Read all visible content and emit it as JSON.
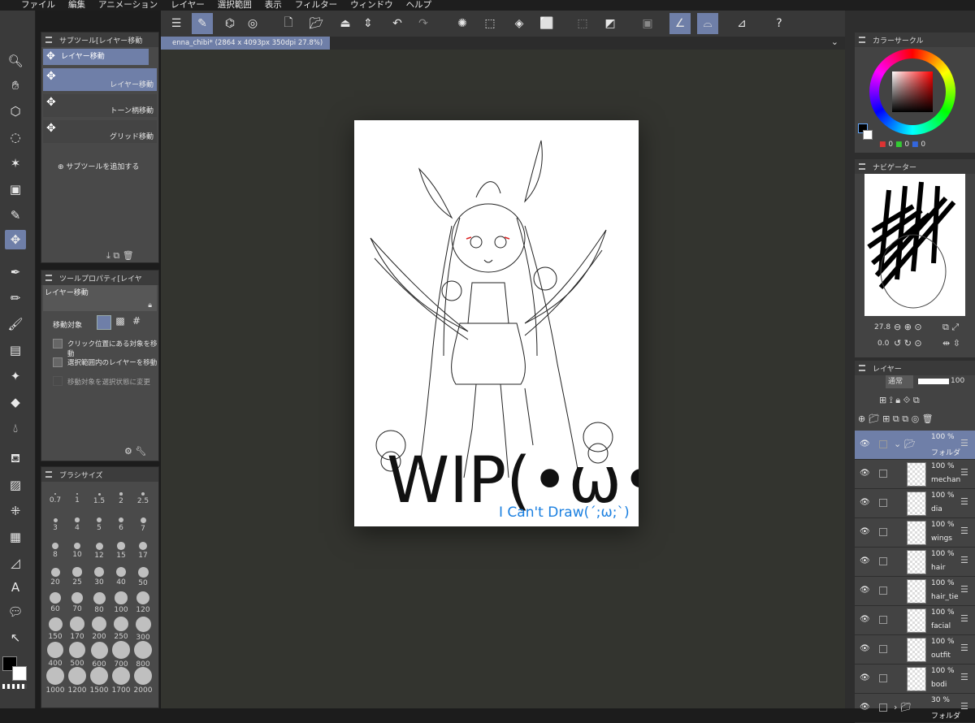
{
  "menu": {
    "items": [
      "ファイル",
      "編集",
      "アニメーション",
      "レイヤー",
      "選択範囲",
      "表示",
      "フィルター",
      "ウィンドウ",
      "ヘルプ"
    ]
  },
  "document": {
    "tab_label": "enna_chibi* (2864 x 4093px 350dpi 27.8%)"
  },
  "subtool": {
    "header": "サブツール[レイヤー移動",
    "active_group": "レイヤー移動",
    "items": [
      "レイヤー移動",
      "トーン柄移動",
      "グリッド移動"
    ],
    "add_label": "サブツールを追加する"
  },
  "tool_property": {
    "header": "ツールプロパティ[レイヤ",
    "tool_name": "レイヤー移動",
    "move_target_label": "移動対象",
    "options": [
      "クリック位置にある対象を移動",
      "選択範囲内のレイヤーを移動",
      "移動対象を選択状態に変更"
    ]
  },
  "brush_size": {
    "header": "ブラシサイズ",
    "sizes": [
      "0.7",
      "1",
      "1.5",
      "2",
      "2.5",
      "3",
      "4",
      "5",
      "6",
      "7",
      "8",
      "10",
      "12",
      "15",
      "17",
      "20",
      "25",
      "30",
      "40",
      "50",
      "60",
      "70",
      "80",
      "100",
      "120",
      "150",
      "170",
      "200",
      "250",
      "300",
      "400",
      "500",
      "600",
      "700",
      "800",
      "1000",
      "1200",
      "1500",
      "1700",
      "2000"
    ]
  },
  "color_circle": {
    "header": "カラーサークル",
    "rgb": [
      "0",
      "0",
      "0"
    ]
  },
  "navigator": {
    "header": "ナビゲーター",
    "zoom": "27.8",
    "rotation": "0.0"
  },
  "layers_panel": {
    "header": "レイヤー",
    "blend_mode": "通常",
    "opacity": "100",
    "layers": [
      {
        "pct": "100 %",
        "name": "フォルダ"
      },
      {
        "pct": "100 %",
        "name": "mechani"
      },
      {
        "pct": "100 %",
        "name": "dia"
      },
      {
        "pct": "100 %",
        "name": "wings"
      },
      {
        "pct": "100 %",
        "name": "hair"
      },
      {
        "pct": "100 %",
        "name": "hair_tie"
      },
      {
        "pct": "100 %",
        "name": "facial"
      },
      {
        "pct": "100 %",
        "name": "outfit"
      },
      {
        "pct": "100 %",
        "name": "bodi"
      },
      {
        "pct": "30 %",
        "name": "フォルダ"
      }
    ]
  },
  "artwork": {
    "wip_text": "WIP(•ω•)",
    "sub_text": "I Can't Draw(´;ω;`)"
  },
  "colors": {
    "accent": "#6f7fa8",
    "canvas_bg": "#33342f",
    "sub_text": "#1a7fe0"
  }
}
